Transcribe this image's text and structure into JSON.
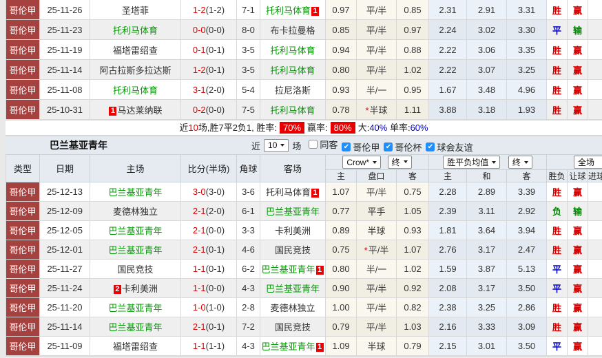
{
  "colors": {
    "type_cell_bg": "#A5413F",
    "focus_team_green": "#009900",
    "score_red": "#E00000",
    "win_red": "#D40000",
    "draw_blue": "#0000CC",
    "lose_green": "#008800",
    "pill_red": "#E80000",
    "checkbox_blue": "#1E8FFF"
  },
  "top_table": {
    "rows": [
      {
        "league": "哥伦甲",
        "date": "25-11-26",
        "home": {
          "name": "圣塔菲",
          "green": false
        },
        "score": "1-2",
        "half": "(1-2)",
        "corner": "7-1",
        "away": {
          "name": "托利马体育",
          "green": true,
          "badge": "1",
          "badge_pos": "after"
        },
        "ah": [
          "0.97",
          "平/半",
          "0.85"
        ],
        "star": false,
        "euro": [
          "2.31",
          "2.91",
          "3.31"
        ],
        "wdl": {
          "t": "胜",
          "c": "red"
        },
        "ah_res": {
          "t": "赢",
          "c": "red"
        }
      },
      {
        "league": "哥伦甲",
        "date": "25-11-23",
        "home": {
          "name": "托利马体育",
          "green": true
        },
        "score": "0-0",
        "half": "(0-0)",
        "corner": "8-0",
        "away": {
          "name": "布卡拉曼格",
          "green": false
        },
        "ah": [
          "0.85",
          "平/半",
          "0.97"
        ],
        "star": false,
        "euro": [
          "2.24",
          "3.02",
          "3.30"
        ],
        "wdl": {
          "t": "平",
          "c": "blue"
        },
        "ah_res": {
          "t": "输",
          "c": "green"
        }
      },
      {
        "league": "哥伦甲",
        "date": "25-11-19",
        "home": {
          "name": "福塔雷绍查",
          "green": false
        },
        "score": "0-1",
        "half": "(0-1)",
        "corner": "3-5",
        "away": {
          "name": "托利马体育",
          "green": true
        },
        "ah": [
          "0.94",
          "平/半",
          "0.88"
        ],
        "star": false,
        "euro": [
          "2.22",
          "3.06",
          "3.35"
        ],
        "wdl": {
          "t": "胜",
          "c": "red"
        },
        "ah_res": {
          "t": "赢",
          "c": "red"
        }
      },
      {
        "league": "哥伦甲",
        "date": "25-11-14",
        "home": {
          "name": "阿古拉斯多拉达斯",
          "green": false
        },
        "score": "1-2",
        "half": "(0-1)",
        "corner": "3-5",
        "away": {
          "name": "托利马体育",
          "green": true
        },
        "ah": [
          "0.80",
          "平/半",
          "1.02"
        ],
        "star": false,
        "euro": [
          "2.22",
          "3.07",
          "3.25"
        ],
        "wdl": {
          "t": "胜",
          "c": "red"
        },
        "ah_res": {
          "t": "赢",
          "c": "red"
        }
      },
      {
        "league": "哥伦甲",
        "date": "25-11-08",
        "home": {
          "name": "托利马体育",
          "green": true
        },
        "score": "3-1",
        "half": "(2-0)",
        "corner": "5-4",
        "away": {
          "name": "拉尼洛斯",
          "green": false
        },
        "ah": [
          "0.93",
          "半/一",
          "0.95"
        ],
        "star": false,
        "euro": [
          "1.67",
          "3.48",
          "4.96"
        ],
        "wdl": {
          "t": "胜",
          "c": "red"
        },
        "ah_res": {
          "t": "赢",
          "c": "red"
        }
      },
      {
        "league": "哥伦甲",
        "date": "25-10-31",
        "home": {
          "name": "马达莱纳联",
          "green": false,
          "badge": "1",
          "badge_pos": "before"
        },
        "score": "0-2",
        "half": "(0-0)",
        "corner": "7-5",
        "away": {
          "name": "托利马体育",
          "green": true
        },
        "ah": [
          "0.78",
          "半球",
          "1.11"
        ],
        "star": true,
        "euro": [
          "3.88",
          "3.18",
          "1.93"
        ],
        "wdl": {
          "t": "胜",
          "c": "red"
        },
        "ah_res": {
          "t": "赢",
          "c": "red"
        }
      }
    ],
    "summary_segments": [
      {
        "t": "近",
        "c": "k"
      },
      {
        "t": "10",
        "c": "r"
      },
      {
        "t": "场,胜7平2负1, 胜率:",
        "c": "k"
      },
      {
        "t": "70%",
        "c": "box"
      },
      {
        "t": "赢率:",
        "c": "k"
      },
      {
        "t": "80%",
        "c": "box"
      },
      {
        "t": "大:",
        "c": "k"
      },
      {
        "t": "40%",
        "c": "b"
      },
      {
        "t": " 单率:",
        "c": "k"
      },
      {
        "t": "60%",
        "c": "b"
      }
    ]
  },
  "section": {
    "title": "巴兰基亚青年",
    "near": "近",
    "count": "10",
    "games": "场",
    "checks": [
      {
        "label": "同客",
        "on": false
      },
      {
        "label": "哥伦甲",
        "on": true
      },
      {
        "label": "哥伦杯",
        "on": true
      },
      {
        "label": "球会友谊",
        "on": true
      }
    ]
  },
  "bottom_table": {
    "top_headers": [
      "类型",
      "日期",
      "主场",
      "比分(半场)",
      "角球",
      "客场"
    ],
    "selects": {
      "provider": "Crow*",
      "final_a": "终",
      "avg": "胜平负均值",
      "final_b": "终",
      "scope": "全场"
    },
    "sub_headers": [
      "主",
      "盘口",
      "客",
      "主",
      "和",
      "客",
      "胜负",
      "让球",
      "进球"
    ],
    "rows": [
      {
        "league": "哥伦甲",
        "date": "25-12-13",
        "home": {
          "name": "巴兰基亚青年",
          "green": true
        },
        "score": "3-0",
        "half": "(3-0)",
        "corner": "3-6",
        "away": {
          "name": "托利马体育",
          "green": false,
          "badge": "1",
          "badge_pos": "after"
        },
        "ah": [
          "1.07",
          "平/半",
          "0.75"
        ],
        "star": false,
        "euro": [
          "2.28",
          "2.89",
          "3.39"
        ],
        "wdl": {
          "t": "胜",
          "c": "red"
        },
        "ah_res": {
          "t": "赢",
          "c": "red"
        }
      },
      {
        "league": "哥伦甲",
        "date": "25-12-09",
        "home": {
          "name": "麦德林独立",
          "green": false
        },
        "score": "2-1",
        "half": "(2-0)",
        "corner": "6-1",
        "away": {
          "name": "巴兰基亚青年",
          "green": true
        },
        "ah": [
          "0.77",
          "平手",
          "1.05"
        ],
        "star": false,
        "euro": [
          "2.39",
          "3.11",
          "2.92"
        ],
        "wdl": {
          "t": "负",
          "c": "green"
        },
        "ah_res": {
          "t": "输",
          "c": "green"
        }
      },
      {
        "league": "哥伦甲",
        "date": "25-12-05",
        "home": {
          "name": "巴兰基亚青年",
          "green": true
        },
        "score": "2-1",
        "half": "(0-0)",
        "corner": "3-3",
        "away": {
          "name": "卡利美洲",
          "green": false
        },
        "ah": [
          "0.89",
          "半球",
          "0.93"
        ],
        "star": false,
        "euro": [
          "1.81",
          "3.64",
          "3.94"
        ],
        "wdl": {
          "t": "胜",
          "c": "red"
        },
        "ah_res": {
          "t": "赢",
          "c": "red"
        }
      },
      {
        "league": "哥伦甲",
        "date": "25-12-01",
        "home": {
          "name": "巴兰基亚青年",
          "green": true
        },
        "score": "2-1",
        "half": "(0-1)",
        "corner": "4-6",
        "away": {
          "name": "国民竞技",
          "green": false
        },
        "ah": [
          "0.75",
          "平/半",
          "1.07"
        ],
        "star": true,
        "euro": [
          "2.76",
          "3.17",
          "2.47"
        ],
        "wdl": {
          "t": "胜",
          "c": "red"
        },
        "ah_res": {
          "t": "赢",
          "c": "red"
        }
      },
      {
        "league": "哥伦甲",
        "date": "25-11-27",
        "home": {
          "name": "国民竞技",
          "green": false
        },
        "score": "1-1",
        "half": "(0-1)",
        "corner": "6-2",
        "away": {
          "name": "巴兰基亚青年",
          "green": true,
          "badge": "1",
          "badge_pos": "after"
        },
        "ah": [
          "0.80",
          "半/一",
          "1.02"
        ],
        "star": false,
        "euro": [
          "1.59",
          "3.87",
          "5.13"
        ],
        "wdl": {
          "t": "平",
          "c": "blue"
        },
        "ah_res": {
          "t": "赢",
          "c": "red"
        }
      },
      {
        "league": "哥伦甲",
        "date": "25-11-24",
        "home": {
          "name": "卡利美洲",
          "green": false,
          "badge": "2",
          "badge_pos": "before"
        },
        "score": "1-1",
        "half": "(0-0)",
        "corner": "4-3",
        "away": {
          "name": "巴兰基亚青年",
          "green": true
        },
        "ah": [
          "0.90",
          "平/半",
          "0.92"
        ],
        "star": false,
        "euro": [
          "2.08",
          "3.17",
          "3.50"
        ],
        "wdl": {
          "t": "平",
          "c": "blue"
        },
        "ah_res": {
          "t": "赢",
          "c": "red"
        }
      },
      {
        "league": "哥伦甲",
        "date": "25-11-20",
        "home": {
          "name": "巴兰基亚青年",
          "green": true
        },
        "score": "1-0",
        "half": "(1-0)",
        "corner": "2-8",
        "away": {
          "name": "麦德林独立",
          "green": false
        },
        "ah": [
          "1.00",
          "平/半",
          "0.82"
        ],
        "star": false,
        "euro": [
          "2.38",
          "3.25",
          "2.86"
        ],
        "wdl": {
          "t": "胜",
          "c": "red"
        },
        "ah_res": {
          "t": "赢",
          "c": "red"
        }
      },
      {
        "league": "哥伦甲",
        "date": "25-11-14",
        "home": {
          "name": "巴兰基亚青年",
          "green": true
        },
        "score": "2-1",
        "half": "(0-1)",
        "corner": "7-2",
        "away": {
          "name": "国民竞技",
          "green": false
        },
        "ah": [
          "0.79",
          "平/半",
          "1.03"
        ],
        "star": false,
        "euro": [
          "2.16",
          "3.33",
          "3.09"
        ],
        "wdl": {
          "t": "胜",
          "c": "red"
        },
        "ah_res": {
          "t": "赢",
          "c": "red"
        }
      },
      {
        "league": "哥伦甲",
        "date": "25-11-09",
        "home": {
          "name": "福塔雷绍查",
          "green": false
        },
        "score": "1-1",
        "half": "(1-1)",
        "corner": "4-3",
        "away": {
          "name": "巴兰基亚青年",
          "green": true,
          "badge": "1",
          "badge_pos": "after"
        },
        "ah": [
          "1.09",
          "半球",
          "0.79"
        ],
        "star": false,
        "euro": [
          "2.15",
          "3.01",
          "3.50"
        ],
        "wdl": {
          "t": "平",
          "c": "blue"
        },
        "ah_res": {
          "t": "赢",
          "c": "red"
        }
      }
    ]
  }
}
